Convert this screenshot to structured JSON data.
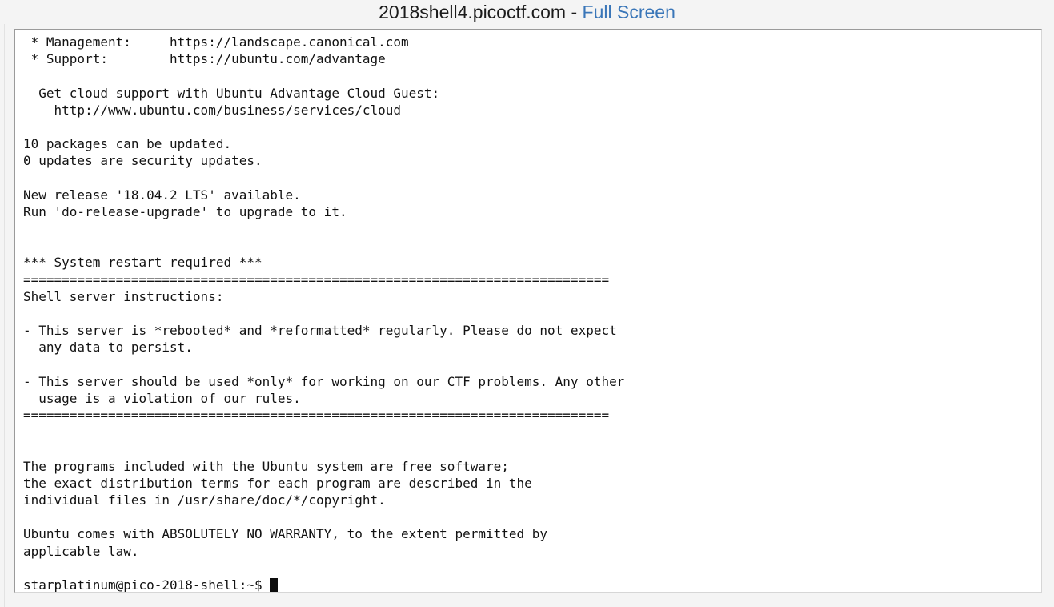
{
  "header": {
    "host": "2018shell4.picoctf.com",
    "separator": " - ",
    "fullscreen_label": "Full Screen",
    "link_color": "#3a76b8",
    "title_color": "#1b1b1b"
  },
  "terminal": {
    "background": "#ffffff",
    "foreground": "#121212",
    "border_color": "#9a9a9a",
    "cursor": {
      "style": "block",
      "color": "#0d0d0d"
    },
    "prompt": "starplatinum@pico-2018-shell:~$ ",
    "user": "starplatinum",
    "hostname": "pico-2018-shell",
    "cwd": "~",
    "lines": [
      " * Management:     https://landscape.canonical.com",
      " * Support:        https://ubuntu.com/advantage",
      "",
      "  Get cloud support with Ubuntu Advantage Cloud Guest:",
      "    http://www.ubuntu.com/business/services/cloud",
      "",
      "10 packages can be updated.",
      "0 updates are security updates.",
      "",
      "New release '18.04.2 LTS' available.",
      "Run 'do-release-upgrade' to upgrade to it.",
      "",
      "",
      "*** System restart required ***",
      "============================================================================",
      "Shell server instructions:",
      "",
      "- This server is *rebooted* and *reformatted* regularly. Please do not expect",
      "  any data to persist.",
      "",
      "- This server should be used *only* for working on our CTF problems. Any other",
      "  usage is a violation of our rules.",
      "============================================================================",
      "",
      "",
      "The programs included with the Ubuntu system are free software;",
      "the exact distribution terms for each program are described in the",
      "individual files in /usr/share/doc/*/copyright.",
      "",
      "Ubuntu comes with ABSOLUTELY NO WARRANTY, to the extent permitted by",
      "applicable law.",
      ""
    ]
  }
}
